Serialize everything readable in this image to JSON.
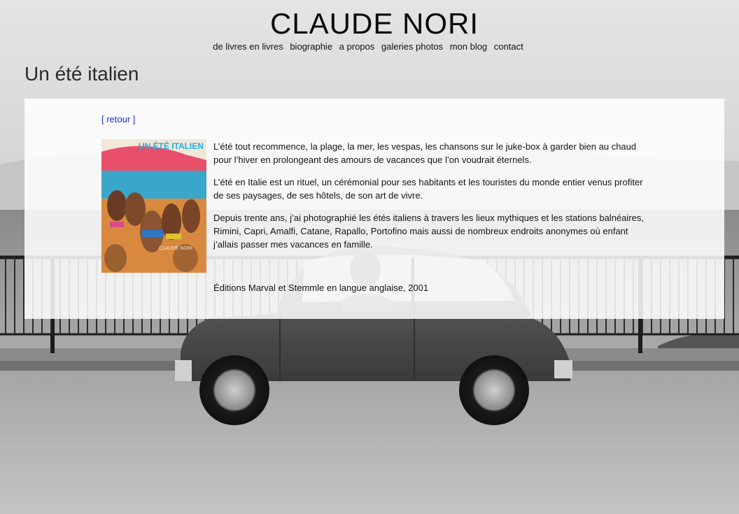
{
  "header": {
    "site_title": "CLAUDE NORI",
    "nav": [
      {
        "label": "de livres en livres"
      },
      {
        "label": "biographie"
      },
      {
        "label": "a propos"
      },
      {
        "label": "galeries photos"
      },
      {
        "label": "mon blog"
      },
      {
        "label": "contact"
      }
    ]
  },
  "page": {
    "title": "Un été italien",
    "back_link": "[ retour ]",
    "cover": {
      "title": "UN ÉTÉ ITALIEN",
      "author": "CLAUDE NORI"
    },
    "paragraphs": [
      "L’été tout recommence, la plage, la mer, les vespas, les chansons sur le juke-box à garder bien au chaud pour l’hiver en prolongeant des amours de vacances que l’on voudrait éternels.",
      "L’été en Italie est un rituel, un cérémonial pour ses habitants et les touristes du monde entier venus profiter de ses paysages, de ses hôtels, de son art de vivre.",
      "Depuis trente ans, j’ai photographié les étés italiens à travers les lieux mythiques et les stations balnéaires, Rimini, Capri, Amalfi, Catane, Rapallo, Portofino mais aussi de nombreux endroits anonymes où enfant j’allais passer mes vacances en famille."
    ],
    "edition": "Éditions Marval et Stemmle en langue anglaise, 2001"
  },
  "colors": {
    "link": "#1a2ed0",
    "cover_title": "#1fb0e6"
  }
}
